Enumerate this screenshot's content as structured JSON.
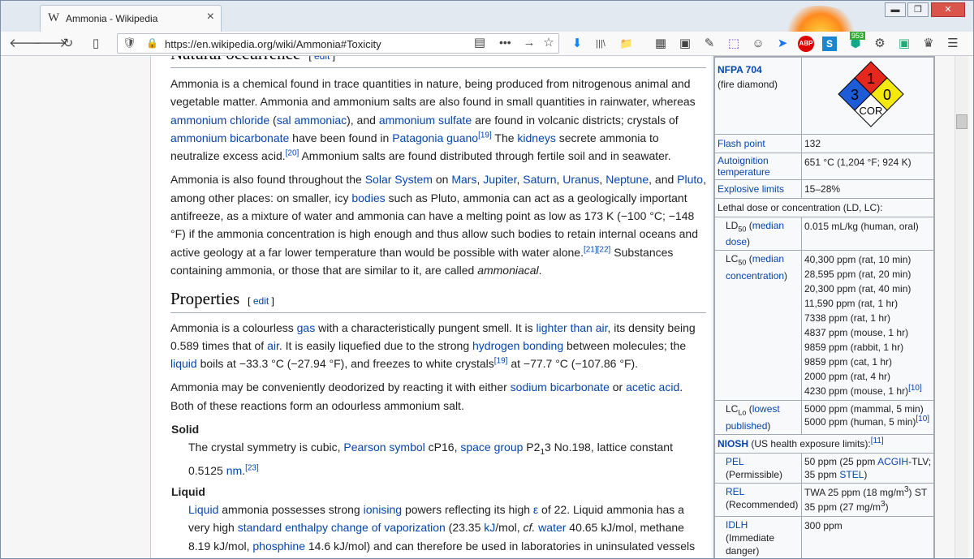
{
  "window": {
    "tab_title": "Ammonia - Wikipedia",
    "url": "https://en.wikipedia.org/wiki/Ammonia#Toxicity",
    "tab_icon": "W",
    "min_glyph": "▬",
    "max_glyph": "❐",
    "close_glyph": "✕"
  },
  "toolbar": {
    "back": "🡐",
    "forward": "🡒",
    "reload": "↻",
    "sidebar": "▯",
    "shield": "🛡",
    "lock": "🔒",
    "reader": "▤",
    "more": "•••",
    "go": "→",
    "star": "☆",
    "downloads": "⬇",
    "library": "|||\\",
    "folder": "📁",
    "ext_badge": "953",
    "abp": "ABP",
    "menu": "☰"
  },
  "article": {
    "nat_heading": "Natural occurrence",
    "edit_label": "edit",
    "nat_p1": {
      "t1": "Ammonia is a chemical found in trace quantities in nature, being produced from nitrogenous animal and vegetable matter. Ammonia and ammonium salts are also found in small quantities in rainwater, whereas ",
      "l1": "ammonium chloride",
      "t2": " (",
      "l2": "sal ammoniac",
      "t3": "), and ",
      "l3": "ammonium sulfate",
      "t4": " are found in volcanic districts; crystals of ",
      "l4": "ammonium bicarbonate",
      "t5": " have been found in ",
      "l5": "Patagonia guano",
      "s1": "[19]",
      "t6": " The ",
      "l6": "kidneys",
      "t7": " secrete ammonia to neutralize excess acid.",
      "s2": "[20]",
      "t8": " Ammonium salts are found distributed through fertile soil and in seawater."
    },
    "nat_p2": {
      "t1": "Ammonia is also found throughout the ",
      "l1": "Solar System",
      "t2": " on ",
      "l2": "Mars",
      "c1": ", ",
      "l3": "Jupiter",
      "c2": ", ",
      "l4": "Saturn",
      "c3": ", ",
      "l5": "Uranus",
      "c4": ", ",
      "l6": "Neptune",
      "t3": ", and ",
      "l7": "Pluto",
      "t4": ", among other places: on smaller, icy ",
      "l8": "bodies",
      "t5": " such as Pluto, ammonia can act as a geologically important antifreeze, as a mixture of water and ammonia can have a melting point as low as 173 K (−100 °C; −148 °F) if the ammonia concentration is high enough and thus allow such bodies to retain internal oceans and active geology at a far lower temperature than would be possible with water alone.",
      "s1": "[21]",
      "s2": "[22]",
      "t6": " Substances containing ammonia, or those that are similar to it, are called ",
      "em": "ammoniacal",
      "t7": "."
    },
    "prop_heading": "Properties",
    "prop_p1": {
      "t1": "Ammonia is a colourless ",
      "l1": "gas",
      "t2": " with a characteristically pungent smell. It is ",
      "l2": "lighter than air",
      "t3": ", its density being 0.589 times that of ",
      "l3": "air",
      "t4": ". It is easily liquefied due to the strong ",
      "l4": "hydrogen bonding",
      "t5": " between molecules; the ",
      "l5": "liquid",
      "t6": " boils at −33.3 °C (−27.94 °F), and freezes to white crystals",
      "s1": "[19]",
      "t7": " at −77.7 °C (−107.86 °F)."
    },
    "prop_p2": {
      "t1": "Ammonia may be conveniently deodorized by reacting it with either ",
      "l1": "sodium bicarbonate",
      "t2": " or ",
      "l2": "acetic acid",
      "t3": ". Both of these reactions form an odourless ammonium salt."
    },
    "solid_dt": "Solid",
    "solid_dd": {
      "t1": "The crystal symmetry is cubic, ",
      "l1": "Pearson symbol",
      "t2": " cP16, ",
      "l2": "space group",
      "t3": " P2",
      "sub": "1",
      "t4": "3 No.198, lattice constant 0.5125 ",
      "l3": "nm",
      "t5": ".",
      "s1": "[23]"
    },
    "liquid_dt": "Liquid",
    "liquid_dd": {
      "l1": "Liquid",
      "t1": " ammonia possesses strong ",
      "l2": "ionising",
      "t2": " powers reflecting its high ",
      "l3": "ε",
      "t3": " of 22. Liquid ammonia has a very high ",
      "l4": "standard enthalpy change of vaporization",
      "t4": " (23.35 ",
      "l5": "kJ",
      "t5": "/mol, ",
      "em": "cf.",
      "t6": " ",
      "l6": "water",
      "t7": " 40.65 kJ/mol, methane 8.19 kJ/mol, ",
      "l7": "phosphine",
      "t8": " 14.6 kJ/mol) and can therefore be used in laboratories in uninsulated vessels"
    }
  },
  "infobox": {
    "nfpa_label": "NFPA 704",
    "nfpa_sub": "(fire diamond)",
    "nfpa": {
      "health": "3",
      "fire": "1",
      "reactivity": "0",
      "special": "COR"
    },
    "colors": {
      "health": "#1e5bd6",
      "fire": "#e5281e",
      "reactivity": "#f5e80d",
      "special": "#ffffff"
    },
    "flash_label": "Flash point",
    "flash_val": "132",
    "auto_label1": "Autoignition",
    "auto_label2": "temperature",
    "auto_val": "651 °C (1,204 °F; 924 K)",
    "expl_label": "Explosive limits",
    "expl_val": "15–28%",
    "lethal_header": "Lethal dose or concentration (LD, LC):",
    "ld50": {
      "pre": "LD",
      "sub": "50",
      "paren1": " (",
      "link": "median dose",
      "paren2": ")",
      "val": "0.015 mL/kg (human, oral)"
    },
    "lc50": {
      "pre": "LC",
      "sub": "50",
      "paren1": " (",
      "link": "median concentration",
      "paren2": ")",
      "vals": [
        "40,300 ppm (rat, 10 min)",
        "28,595 ppm (rat, 20 min)",
        "20,300 ppm (rat, 40 min)",
        "11,590 ppm (rat, 1 hr)",
        "7338 ppm (rat, 1 hr)",
        "4837 ppm (mouse, 1 hr)",
        "9859 ppm (rabbit, 1 hr)",
        "9859 ppm (cat, 1 hr)",
        "2000 ppm (rat, 4 hr)",
        "4230 ppm (mouse, 1 hr)"
      ],
      "ref": "[10]"
    },
    "lclo": {
      "pre": "LC",
      "sub": "Lo",
      "paren1": " (",
      "link": "lowest published",
      "paren2": ")",
      "v1": "5000 ppm (mammal, 5 min)",
      "v2": "5000 ppm (human, 5 min)",
      "ref": "[10]"
    },
    "niosh": {
      "link": "NIOSH",
      "text": " (US health exposure limits):",
      "ref": "[11]"
    },
    "pel": {
      "link": "PEL",
      "sub": "(Permissible)",
      "v_pre": "50 ppm (25 ppm ",
      "v_l1": "ACGIH",
      "v_mid": "-TLV; 35 ppm ",
      "v_l2": "STEL",
      "v_post": ")"
    },
    "rel": {
      "link": "REL",
      "sub": "(Recommended)",
      "v1": "TWA 25 ppm (18 mg/m",
      "v1_sup": "3",
      "v1_post": ") ST",
      "v2": "35 ppm (27 mg/m",
      "v2_sup": "3",
      "v2_post": ")"
    },
    "idlh": {
      "link": "IDLH",
      "sub": "(Immediate danger)",
      "val": "300 ppm"
    }
  }
}
